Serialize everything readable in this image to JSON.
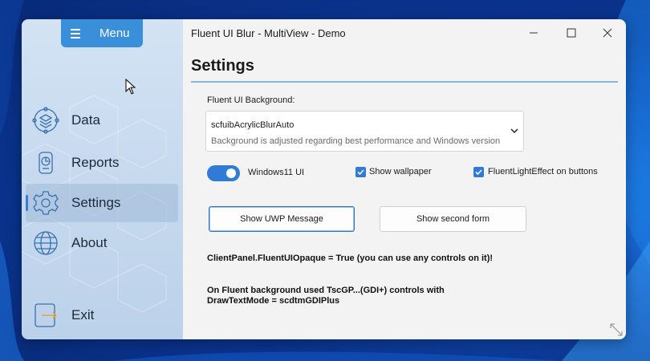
{
  "colors": {
    "accent": "#2f7bd6",
    "menu_button": "#3a8fdb",
    "heading_underline": "#86b4e3",
    "sidebar": "#c6d9ee",
    "client_bg": "#f3f3f3"
  },
  "sidebar": {
    "menu_label": "Menu",
    "items": [
      {
        "label": "Data",
        "icon": "data-layers-icon"
      },
      {
        "label": "Reports",
        "icon": "reports-icon"
      },
      {
        "label": "Settings",
        "icon": "gear-icon",
        "active": true
      },
      {
        "label": "About",
        "icon": "globe-icon"
      },
      {
        "label": "Exit",
        "icon": "exit-icon"
      }
    ]
  },
  "window": {
    "title": "Fluent UI Blur - MultiView - Demo",
    "caption_buttons": [
      "minimize-icon",
      "maximize-icon",
      "close-icon"
    ]
  },
  "settings": {
    "heading": "Settings",
    "background_label": "Fluent UI Background:",
    "combo": {
      "value": "scfuibAcrylicBlurAuto",
      "description": "Background is adjusted regarding best performance and Windows version"
    },
    "windows11_toggle": {
      "label": "Windows11 UI",
      "on": true
    },
    "show_wallpaper": {
      "label": "Show wallpaper",
      "checked": true
    },
    "fluent_light": {
      "label": "FluentLightEffect on buttons",
      "checked": true
    },
    "buttons": {
      "uwp": "Show UWP Message",
      "second_form": "Show second form"
    },
    "info1": "ClientPanel.FluentUIOpaque = True (you can use any controls on it)!",
    "info2_line1": "On Fluent background used TscGP...(GDI+) controls with",
    "info2_line2": "DrawTextMode = scdtmGDIPlus"
  }
}
